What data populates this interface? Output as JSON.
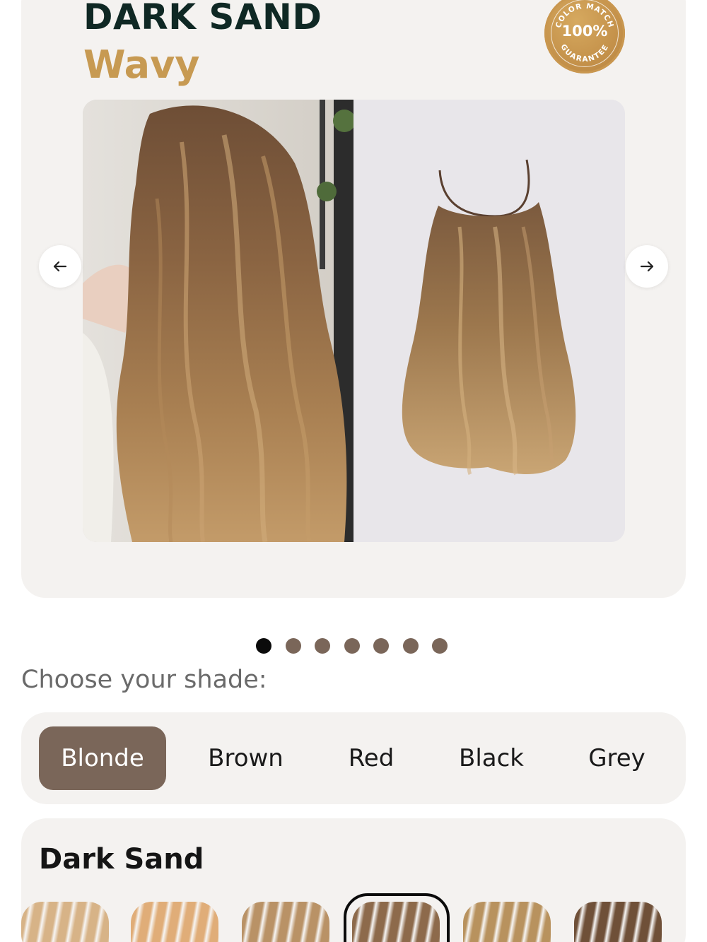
{
  "product": {
    "title": "DARK SAND",
    "subtitle": "Wavy"
  },
  "badge": {
    "top_text": "COLOR MATCH",
    "percent": "100%",
    "bottom_text": "GUARANTEE",
    "color": "#c4914a"
  },
  "gallery": {
    "slide_count": 7,
    "active_index": 0
  },
  "shade_prompt": "Choose your shade:",
  "shade_tabs": [
    {
      "label": "Blonde",
      "active": true
    },
    {
      "label": "Brown",
      "active": false
    },
    {
      "label": "Red",
      "active": false
    },
    {
      "label": "Black",
      "active": false
    },
    {
      "label": "Grey",
      "active": false
    }
  ],
  "variant": {
    "title": "Dark Sand",
    "swatch_colors": [
      "#d7b387",
      "#e0ad78",
      "#b99266",
      "#8d6a4b",
      "#b8925e",
      "#6f5038"
    ],
    "selected_index": 3
  },
  "colors": {
    "accent_brown": "#7a6659",
    "title_dark": "#0f2824",
    "gold": "#c79a52"
  }
}
